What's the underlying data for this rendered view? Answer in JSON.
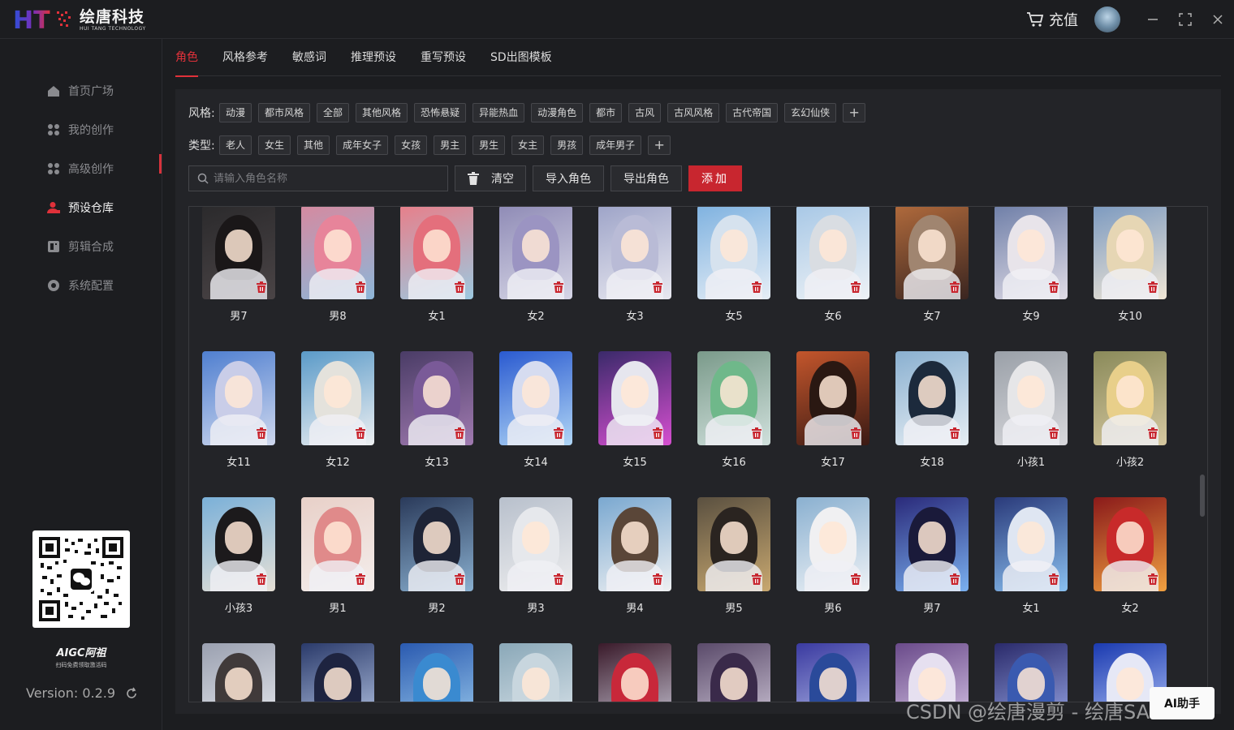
{
  "app": {
    "logo_mark": "HT",
    "logo_cn": "绘唐科技",
    "logo_en": "HUI TANG TECHNOLOGY",
    "recharge_label": "充值",
    "accent": "#d7323c"
  },
  "sidebar": {
    "items": [
      {
        "label": "首页广场",
        "icon": "home-icon"
      },
      {
        "label": "我的创作",
        "icon": "grid-icon"
      },
      {
        "label": "高级创作",
        "icon": "grid-icon"
      },
      {
        "label": "预设仓库",
        "icon": "user-icon",
        "active": true
      },
      {
        "label": "剪辑合成",
        "icon": "film-icon"
      },
      {
        "label": "系统配置",
        "icon": "gear-icon"
      }
    ],
    "brand_name": "AIGC阿祖",
    "brand_sub": "扫码免费领取激活码",
    "version": "Version: 0.2.9"
  },
  "tabs": [
    "角色",
    "风格参考",
    "敏感词",
    "推理预设",
    "重写预设",
    "SD出图模板"
  ],
  "filters": {
    "style_label": "风格:",
    "styles": [
      "动漫",
      "都市风格",
      "全部",
      "其他风格",
      "恐怖悬疑",
      "异能热血",
      "动漫角色",
      "都市",
      "古风",
      "古风风格",
      "古代帝国",
      "玄幻仙侠"
    ],
    "type_label": "类型:",
    "types": [
      "老人",
      "女生",
      "其他",
      "成年女子",
      "女孩",
      "男主",
      "男生",
      "女主",
      "男孩",
      "成年男子"
    ]
  },
  "toolbar": {
    "search_placeholder": "请输入角色名称",
    "clear_label": "清空",
    "import_label": "导入角色",
    "export_label": "导出角色",
    "add_label": "添加"
  },
  "roles": [
    {
      "name": "男7",
      "c1": "#2b2a2c",
      "c2": "#4a4446",
      "hair": "#1a1718"
    },
    {
      "name": "男8",
      "c1": "#d58aa0",
      "c2": "#8db6d8",
      "hair": "#e7849a"
    },
    {
      "name": "女1",
      "c1": "#e77f8a",
      "c2": "#9cc9e0",
      "hair": "#e46f7c"
    },
    {
      "name": "女2",
      "c1": "#8f8bb6",
      "c2": "#d6d6e6",
      "hair": "#9b94c2"
    },
    {
      "name": "女3",
      "c1": "#9ea4c8",
      "c2": "#e8e8f0",
      "hair": "#b9bbd6"
    },
    {
      "name": "女5",
      "c1": "#7fb2e0",
      "c2": "#e6eef6",
      "hair": "#d6e2ee"
    },
    {
      "name": "女6",
      "c1": "#a8c8e6",
      "c2": "#eef2f6",
      "hair": "#d9dde2"
    },
    {
      "name": "女7",
      "c1": "#b06a3c",
      "c2": "#3a2520",
      "hair": "#a08570"
    },
    {
      "name": "女9",
      "c1": "#6f7fa8",
      "c2": "#e0dce6",
      "hair": "#e8e4ea"
    },
    {
      "name": "女10",
      "c1": "#7c9ac0",
      "c2": "#f0e6d6",
      "hair": "#e6d6b4"
    },
    {
      "name": "女11",
      "c1": "#4f7fd0",
      "c2": "#cfd8ee",
      "hair": "#c9cde8"
    },
    {
      "name": "女12",
      "c1": "#5a9ac8",
      "c2": "#eef0f2",
      "hair": "#e4e2dc"
    },
    {
      "name": "女13",
      "c1": "#4a3c66",
      "c2": "#a07ab0",
      "hair": "#7a5a98"
    },
    {
      "name": "女14",
      "c1": "#2a5ad0",
      "c2": "#b0d6f6",
      "hair": "#d6dcf0"
    },
    {
      "name": "女15",
      "c1": "#3a2a6a",
      "c2": "#d64fd0",
      "hair": "#e6e6ee"
    },
    {
      "name": "女16",
      "c1": "#7a9a8a",
      "c2": "#d0e0dc",
      "hair": "#6fb88a"
    },
    {
      "name": "女17",
      "c1": "#c4562c",
      "c2": "#3a1a14",
      "hair": "#2a1812"
    },
    {
      "name": "女18",
      "c1": "#8ab0d0",
      "c2": "#e6eef4",
      "hair": "#1c2a3c"
    },
    {
      "name": "小孩1",
      "c1": "#9aa0a8",
      "c2": "#d8d8dc",
      "hair": "#e6e6e8"
    },
    {
      "name": "小孩2",
      "c1": "#8a8a5a",
      "c2": "#d6c8a0",
      "hair": "#e8cf8a"
    },
    {
      "name": "小孩3",
      "c1": "#7ab0d8",
      "c2": "#e6e0d6",
      "hair": "#1c1a1c"
    },
    {
      "name": "男1",
      "c1": "#e8d0c8",
      "c2": "#f4eeec",
      "hair": "#e08a8a"
    },
    {
      "name": "男2",
      "c1": "#2a3a5a",
      "c2": "#8ab0d0",
      "hair": "#1e2436"
    },
    {
      "name": "男3",
      "c1": "#b8c0cc",
      "c2": "#eeeeef",
      "hair": "#e6e8ec"
    },
    {
      "name": "男4",
      "c1": "#7aa8d0",
      "c2": "#eef0f2",
      "hair": "#5a4638"
    },
    {
      "name": "男5",
      "c1": "#5a5040",
      "c2": "#c8a870",
      "hair": "#2a2420"
    },
    {
      "name": "男6",
      "c1": "#8ab0d0",
      "c2": "#eef2f6",
      "hair": "#f0f0f2"
    },
    {
      "name": "男7",
      "c1": "#2a2a7a",
      "c2": "#7ab0f0",
      "hair": "#1a1a3a"
    },
    {
      "name": "女1",
      "c1": "#2a3a7a",
      "c2": "#8ac0f0",
      "hair": "#dfe6f2"
    },
    {
      "name": "女2",
      "c1": "#8a1a1a",
      "c2": "#f0a040",
      "hair": "#c82a2a"
    },
    {
      "name": "",
      "c1": "#9aa0b0",
      "c2": "#eceef2",
      "hair": "#403a3a"
    },
    {
      "name": "",
      "c1": "#2a3a6a",
      "c2": "#c0d0ee",
      "hair": "#1e2440"
    },
    {
      "name": "",
      "c1": "#2a5ab0",
      "c2": "#a0d0f0",
      "hair": "#3a8ad0"
    },
    {
      "name": "",
      "c1": "#8aa8b8",
      "c2": "#e0e8ee",
      "hair": "#c8d6de"
    },
    {
      "name": "",
      "c1": "#3a1a2a",
      "c2": "#d0d0e0",
      "hair": "#c8283a"
    },
    {
      "name": "",
      "c1": "#5a4a6a",
      "c2": "#d8d0e0",
      "hair": "#3a2a4a"
    },
    {
      "name": "",
      "c1": "#3a3aa0",
      "c2": "#c0c8f0",
      "hair": "#2a4a9a"
    },
    {
      "name": "",
      "c1": "#6a4a8a",
      "c2": "#e0d0ee",
      "hair": "#e6e0f0"
    },
    {
      "name": "",
      "c1": "#2a2a6a",
      "c2": "#a0b0f0",
      "hair": "#3a5ab0"
    },
    {
      "name": "",
      "c1": "#1a3ab0",
      "c2": "#c0d0ff",
      "hair": "#e6e8f6"
    }
  ],
  "watermark": "CSDN @绘唐漫剪 - 绘唐SAIGC",
  "ai_badge": "AI助手"
}
